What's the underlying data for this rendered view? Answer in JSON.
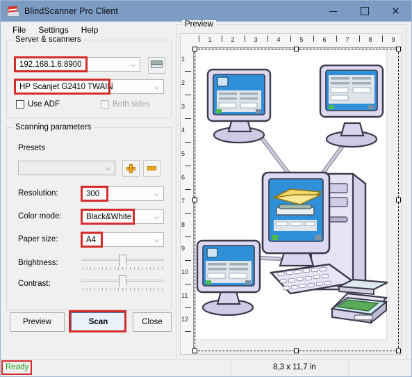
{
  "window": {
    "title": "BlindScanner Pro Client",
    "icon": "scanner-app-icon",
    "minimize": "—",
    "maximize": "□",
    "close": "✕"
  },
  "menu": {
    "items": [
      {
        "label": "File"
      },
      {
        "label": "Settings"
      },
      {
        "label": "Help"
      }
    ]
  },
  "server_group": {
    "legend": "Server & scanners",
    "server_combo": {
      "value": "192.168.1.6:8900",
      "arrow": "⌵",
      "highlighted": true
    },
    "scanner_button": {
      "icon": "scanner-icon"
    },
    "scanner_combo": {
      "value": "HP Scanjet G2410 TWAIN",
      "arrow": "⌵",
      "highlighted": true
    },
    "use_adf": {
      "label": "Use ADF",
      "checked": false,
      "enabled": true
    },
    "both_sides": {
      "label": "Both sides",
      "checked": false,
      "enabled": false
    }
  },
  "scanning_group": {
    "legend": "Scanning parameters",
    "presets_label": "Presets",
    "presets_combo": {
      "value": "",
      "arrow": "⌵"
    },
    "add_preset_button": {
      "icon": "plus-icon"
    },
    "remove_preset_button": {
      "icon": "minus-icon"
    },
    "resolution": {
      "label": "Resolution:",
      "value": "300",
      "arrow": "⌵",
      "highlighted": true
    },
    "color_mode": {
      "label": "Color mode:",
      "value": "Black&White",
      "arrow": "⌵",
      "highlighted": true
    },
    "paper_size": {
      "label": "Paper size:",
      "value": "A4",
      "arrow": "⌵",
      "highlighted": true
    },
    "brightness": {
      "label": "Brightness:",
      "value": 50
    },
    "contrast": {
      "label": "Contrast:",
      "value": 50
    }
  },
  "buttons": {
    "preview": {
      "label": "Preview"
    },
    "scan": {
      "label": "Scan",
      "focused": true,
      "highlighted": true
    },
    "close": {
      "label": "Close"
    }
  },
  "preview": {
    "legend": "Preview",
    "ruler_horizontal": [
      "1",
      "2",
      "3",
      "4",
      "5",
      "6",
      "7",
      "8",
      "9"
    ],
    "ruler_vertical": [
      "1",
      "2",
      "3",
      "4",
      "5",
      "6",
      "7",
      "8",
      "9",
      "10",
      "11",
      "12"
    ],
    "image_description": "network-scanning-illustration"
  },
  "statusbar": {
    "status": "Ready",
    "status_color": "#1f9e1f",
    "status_highlighted": true,
    "page_size": "8,3 x 11,7 in"
  }
}
